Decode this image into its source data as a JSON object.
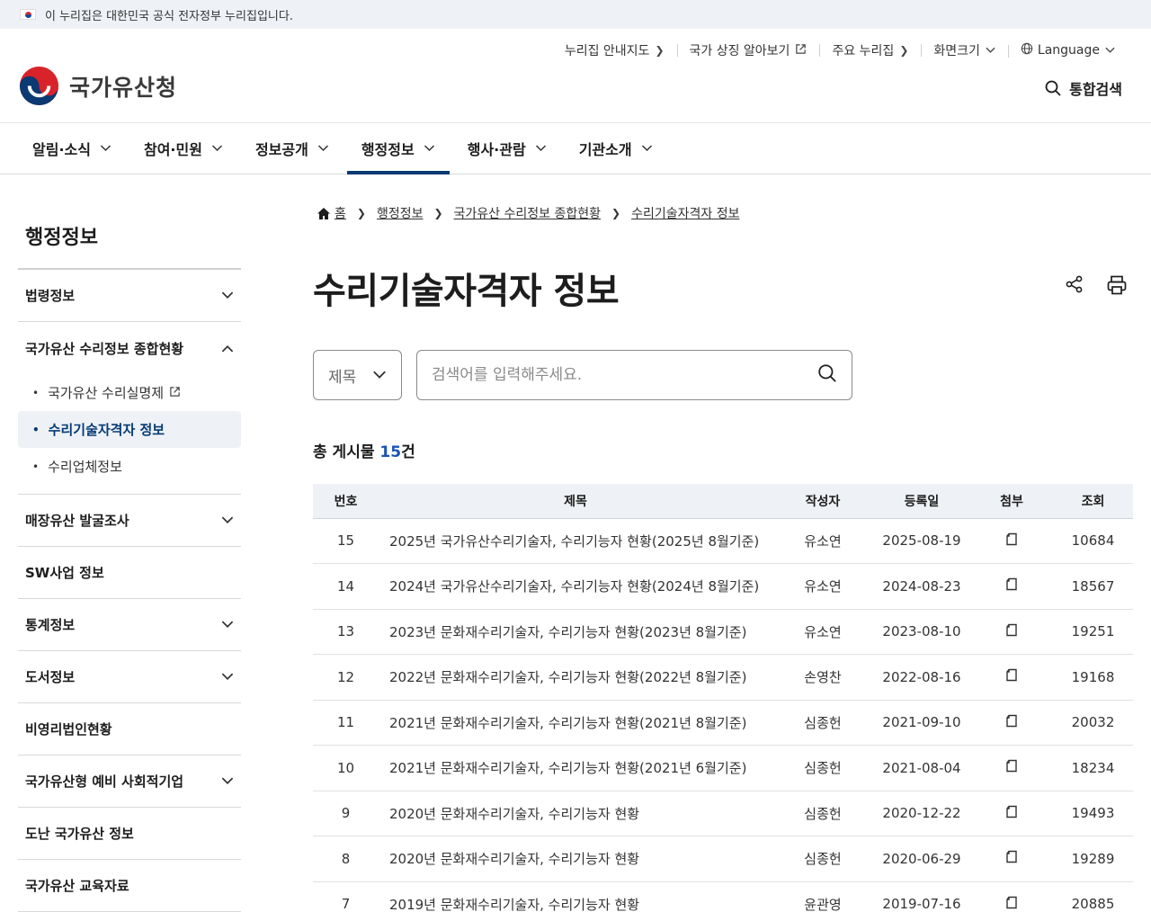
{
  "gov_banner": "이 누리집은 대한민국 공식 전자정부 누리집입니다.",
  "logo": {
    "name": "국가유산청"
  },
  "util_menu": [
    "누리집 안내지도",
    "국가 상징 알아보기",
    "주요 누리집",
    "화면크기",
    "Language"
  ],
  "search_all_label": "통합검색",
  "gnb": [
    "알림·소식",
    "참여·민원",
    "정보공개",
    "행정정보",
    "행사·관람",
    "기관소개"
  ],
  "lnb": {
    "title": "행정정보",
    "items": [
      "법령정보",
      "국가유산 수리정보 종합현황",
      "매장유산 발굴조사",
      "SW사업 정보",
      "통계정보",
      "도서정보",
      "비영리법인현황",
      "국가유산형 예비 사회적기업",
      "도난 국가유산 정보",
      "국가유산 교육자료"
    ],
    "sub_items": [
      "국가유산 수리실명제",
      "수리기술자격자 정보",
      "수리업체정보"
    ]
  },
  "breadcrumb": [
    "홈",
    "행정정보",
    "국가유산 수리정보 종합현황",
    "수리기술자격자 정보"
  ],
  "page_title": "수리기술자격자 정보",
  "search": {
    "select_value": "제목",
    "placeholder": "검색어를 입력해주세요."
  },
  "total": {
    "prefix": "총 게시물 ",
    "count": "15",
    "suffix": "건"
  },
  "table": {
    "headers": [
      "번호",
      "제목",
      "작성자",
      "등록일",
      "첨부",
      "조회"
    ],
    "rows": [
      {
        "no": "15",
        "title": "2025년 국가유산수리기술자, 수리기능자 현황(2025년 8월기준)",
        "writer": "유소연",
        "date": "2025-08-19",
        "views": "10684"
      },
      {
        "no": "14",
        "title": "2024년 국가유산수리기술자, 수리기능자 현황(2024년 8월기준)",
        "writer": "유소연",
        "date": "2024-08-23",
        "views": "18567"
      },
      {
        "no": "13",
        "title": "2023년 문화재수리기술자, 수리기능자 현황(2023년 8월기준)",
        "writer": "유소연",
        "date": "2023-08-10",
        "views": "19251"
      },
      {
        "no": "12",
        "title": "2022년 문화재수리기술자, 수리기능자 현황(2022년 8월기준)",
        "writer": "손영찬",
        "date": "2022-08-16",
        "views": "19168"
      },
      {
        "no": "11",
        "title": "2021년 문화재수리기술자, 수리기능자 현황(2021년 8월기준)",
        "writer": "심종헌",
        "date": "2021-09-10",
        "views": "20032"
      },
      {
        "no": "10",
        "title": "2021년 문화재수리기술자, 수리기능자 현황(2021년 6월기준)",
        "writer": "심종헌",
        "date": "2021-08-04",
        "views": "18234"
      },
      {
        "no": "9",
        "title": "2020년 문화재수리기술자, 수리기능자 현황",
        "writer": "심종헌",
        "date": "2020-12-22",
        "views": "19493"
      },
      {
        "no": "8",
        "title": "2020년 문화재수리기술자, 수리기능자 현황",
        "writer": "심종헌",
        "date": "2020-06-29",
        "views": "19289"
      },
      {
        "no": "7",
        "title": "2019년 문화재수리기술자, 수리기능자 현황",
        "writer": "윤관영",
        "date": "2019-07-16",
        "views": "20885"
      }
    ]
  }
}
